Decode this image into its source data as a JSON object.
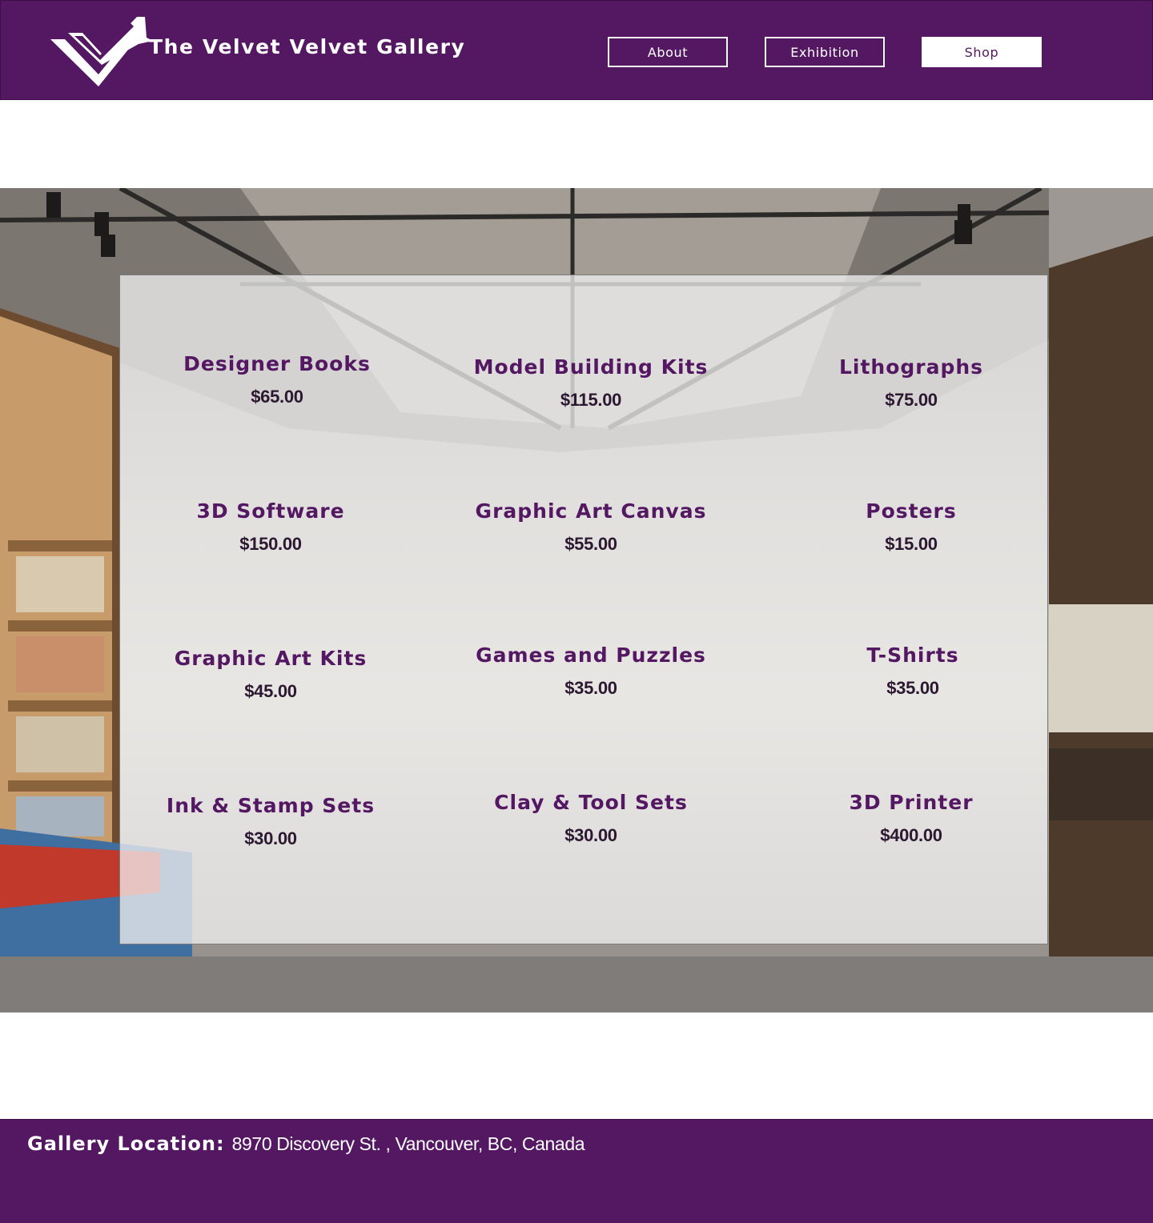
{
  "header": {
    "brand": "The Velvet Velvet Gallery",
    "nav": [
      {
        "label": "About",
        "active": false
      },
      {
        "label": "Exhibition",
        "active": false
      },
      {
        "label": "Shop",
        "active": true
      }
    ]
  },
  "shop": {
    "items": [
      {
        "name": "Designer Books",
        "price": "$65.00"
      },
      {
        "name": "Model Building Kits",
        "price": "$115.00"
      },
      {
        "name": "Lithographs",
        "price": "$75.00"
      },
      {
        "name": "3D Software",
        "price": "$150.00"
      },
      {
        "name": "Graphic Art Canvas",
        "price": "$55.00"
      },
      {
        "name": "Posters",
        "price": "$15.00"
      },
      {
        "name": "Graphic Art Kits",
        "price": "$45.00"
      },
      {
        "name": "Games and Puzzles",
        "price": "$35.00"
      },
      {
        "name": "T-Shirts",
        "price": "$35.00"
      },
      {
        "name": "Ink & Stamp Sets",
        "price": "$30.00"
      },
      {
        "name": "Clay & Tool Sets",
        "price": "$30.00"
      },
      {
        "name": "3D Printer",
        "price": "$400.00"
      }
    ]
  },
  "footer": {
    "location_label": "Gallery Location:",
    "location_text": "8970 Discovery St. , Vancouver, BC, Canada"
  },
  "colors": {
    "brand_purple": "#541863",
    "price_text": "#2c1830",
    "panel_overlay": "rgba(240,240,240,0.76)"
  },
  "icons": {
    "logo": "double-v-chevron-logo"
  }
}
